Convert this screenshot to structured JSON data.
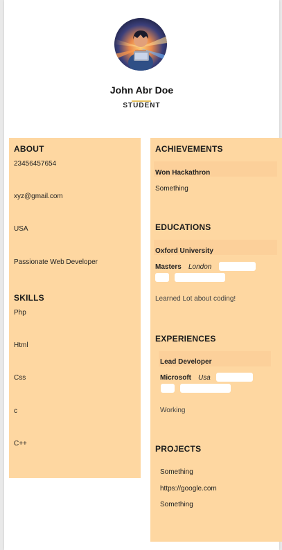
{
  "profile": {
    "name": "John Abr Doe",
    "role": "STUDENT",
    "avatar_icon": "person-with-laptop-illustration"
  },
  "colors": {
    "panel": "#fed7a1",
    "accent_underline": "#e7c05a",
    "page": "#ffffff"
  },
  "about": {
    "heading": "ABOUT",
    "phone": "23456457654",
    "email": "xyz@gmail.com",
    "location": "USA",
    "summary": "Passionate Web Developer"
  },
  "skills": {
    "heading": "SKILLS",
    "items": [
      "Php",
      "Html",
      "Css",
      "c",
      "C++"
    ]
  },
  "achievements": {
    "heading": "ACHIEVEMENTS",
    "title": "Won Hackathron",
    "description": "Something"
  },
  "educations": {
    "heading": "EDUCATIONS",
    "institution": "Oxford University",
    "degree": "Masters",
    "location": "London",
    "description": "Learned Lot about coding!"
  },
  "experiences": {
    "heading": "EXPERIENCES",
    "position": "Lead Developer",
    "company": "Microsoft",
    "location": "Usa",
    "description": "Working"
  },
  "projects": {
    "heading": "PROJECTS",
    "name": "Something",
    "link": "https://google.com",
    "description": "Something"
  }
}
